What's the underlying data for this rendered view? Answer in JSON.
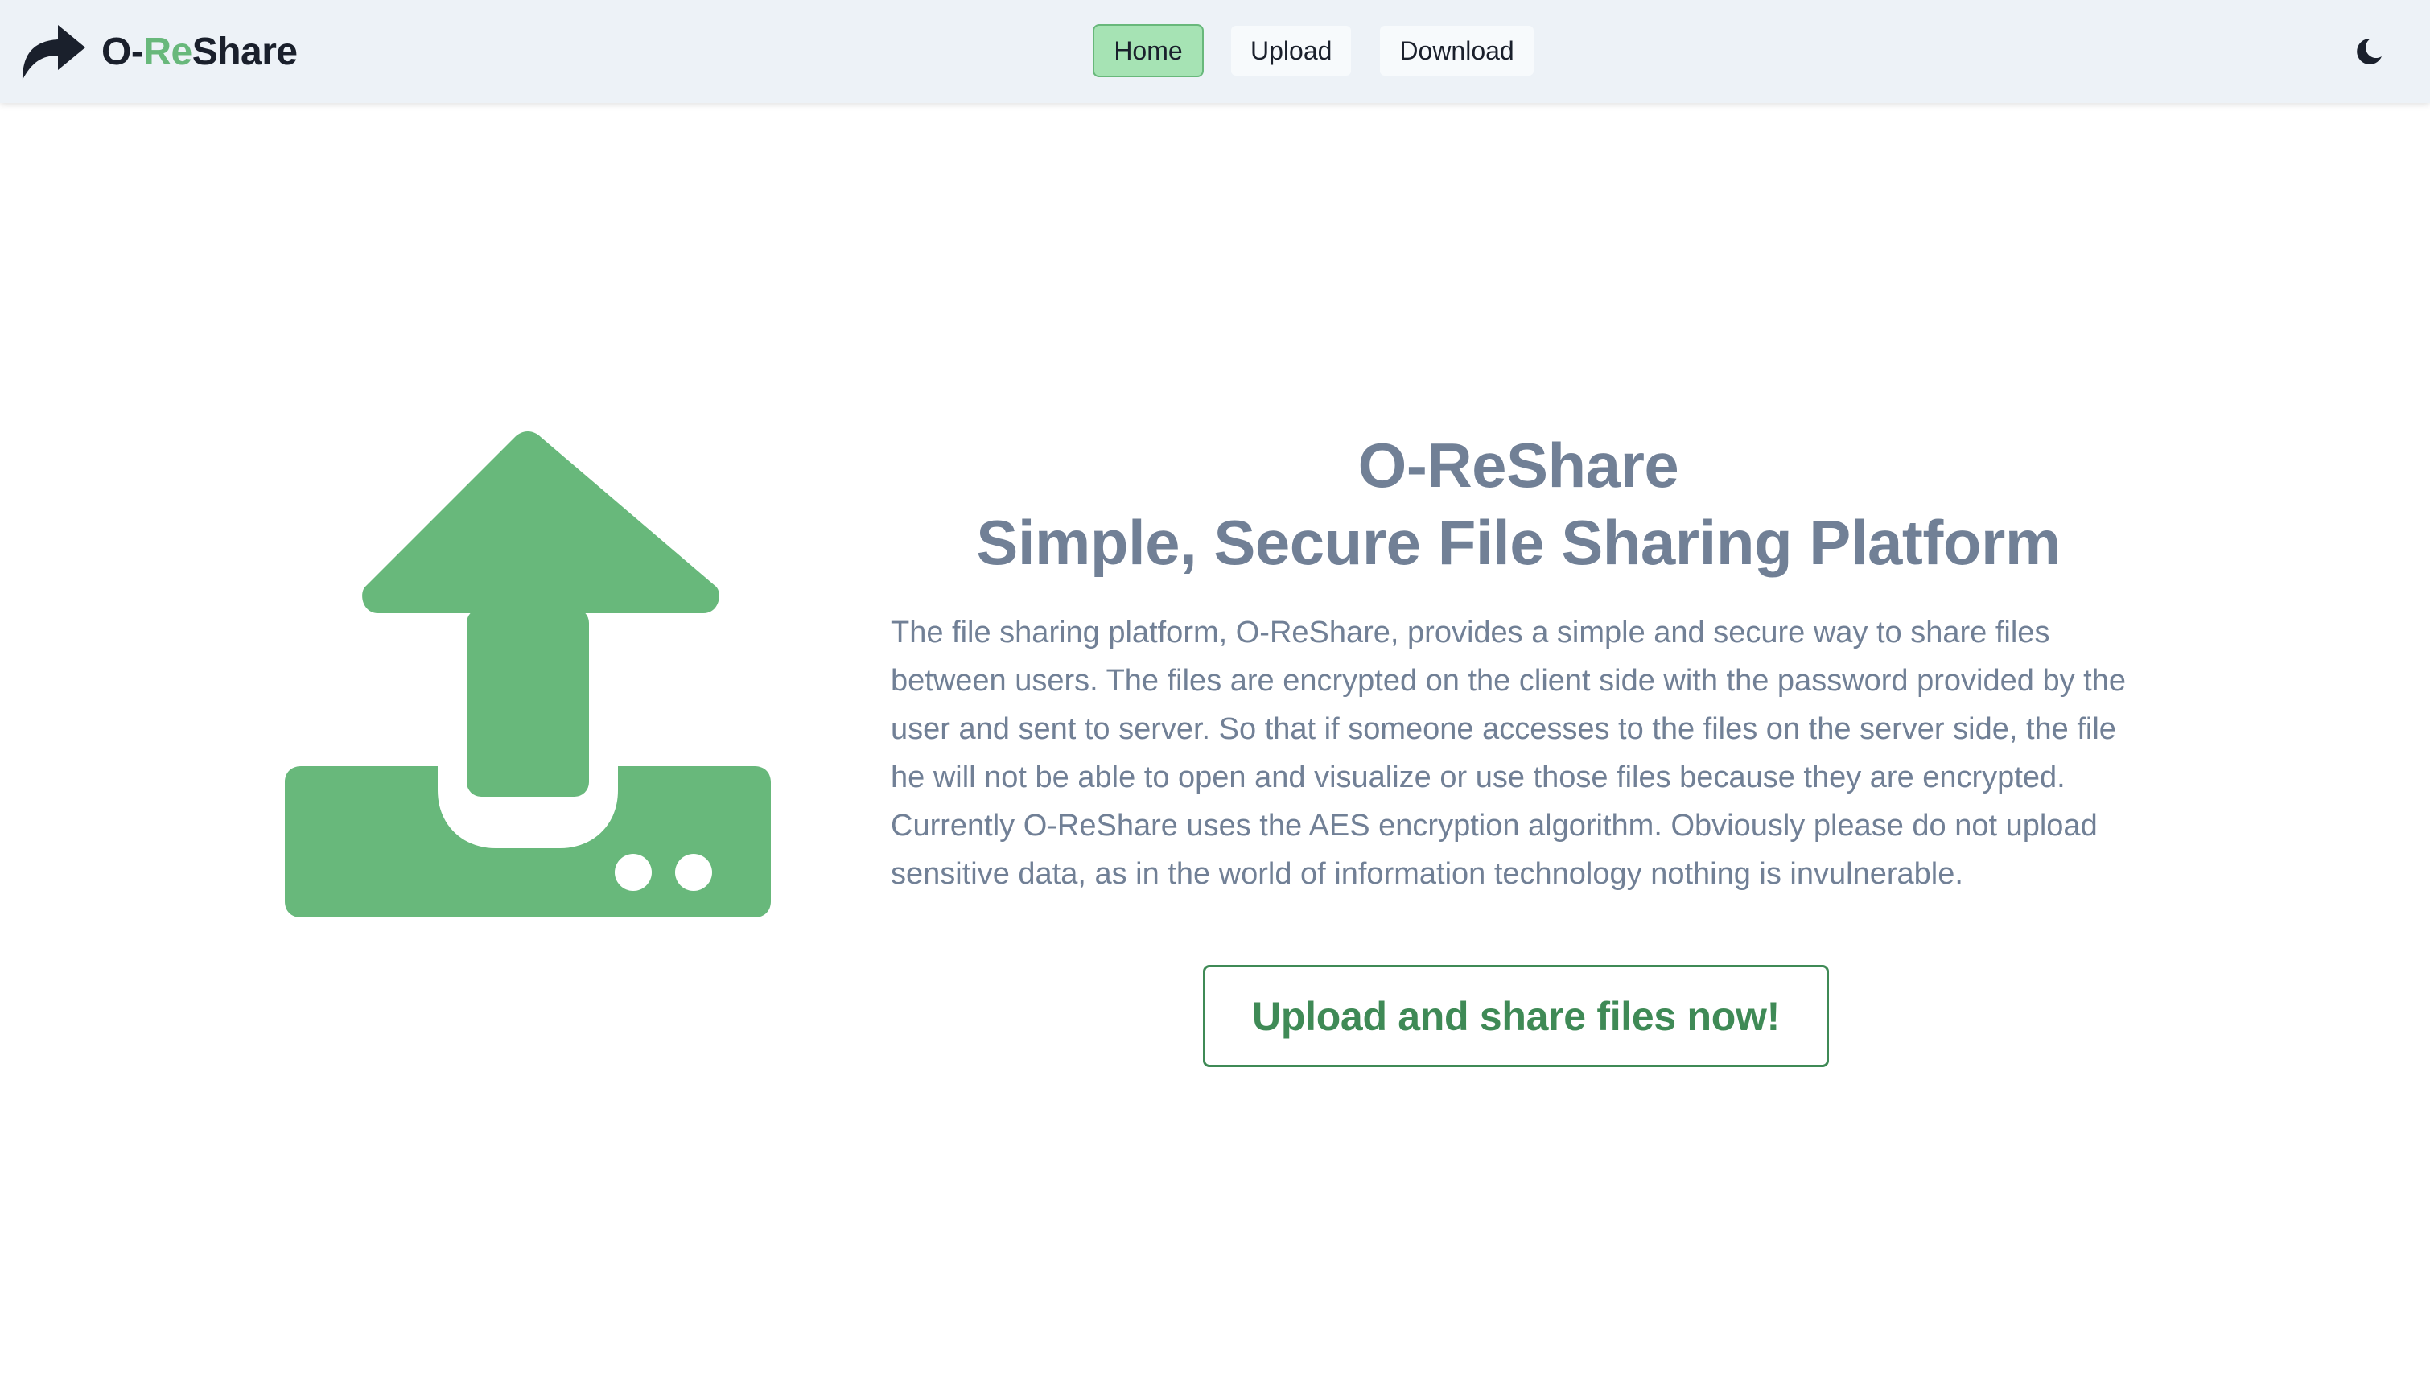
{
  "navbar": {
    "brand": {
      "prefix": "O-",
      "accent": "Re",
      "suffix": "Share",
      "icon": "share-arrow-icon"
    },
    "links": [
      {
        "label": "Home",
        "active": true
      },
      {
        "label": "Upload",
        "active": false
      },
      {
        "label": "Download",
        "active": false
      }
    ],
    "theme_toggle_icon": "moon-icon"
  },
  "hero": {
    "icon": "upload-drive-icon",
    "title_line1": "O-ReShare",
    "title_line2": "Simple, Secure File Sharing Platform",
    "description": "The file sharing platform, O-ReShare, provides a simple and secure way to share files between users. The files are encrypted on the client side with the password provided by the user and sent to server. So that if someone accesses to the files on the server side, the file he will not be able to open and visualize or use those files because they are encrypted. Currently O-ReShare uses the AES encryption algorithm. Obviously please do not upload sensitive data, as in the world of information technology nothing is invulnerable.",
    "cta_label": "Upload and share files now!"
  },
  "colors": {
    "accent": "#68b87b",
    "accent_dark": "#3f8a56",
    "nav_bg": "#edf2f7",
    "active_bg": "#a6e3b4",
    "text_muted": "#718096",
    "text_dark": "#1a202c"
  }
}
